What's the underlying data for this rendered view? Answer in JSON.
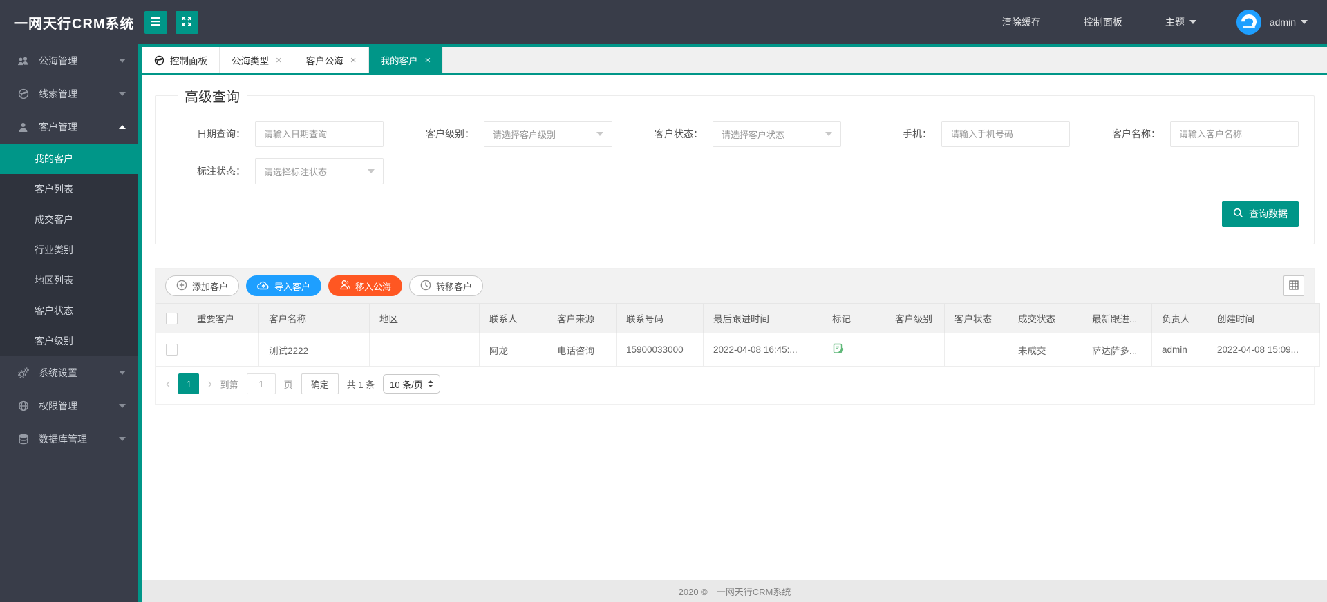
{
  "colors": {
    "accent": "#009688",
    "dark_bg": "#393D49",
    "submenu_bg": "#2F333D",
    "blue": "#1E9FFF",
    "orange": "#FF5722",
    "green_mark": "#5FB878"
  },
  "icons": {
    "hamburger-icon": "menu bars",
    "fullscreen-icon": "expand arrows",
    "chevron-down-icon": "▼",
    "chevron-up-icon": "▲",
    "users-icon": "two persons",
    "globe-icon": "globe",
    "person-icon": "person",
    "gear-icon": "gears",
    "permission-icon": "globe crosshair",
    "database-icon": "cylinder",
    "close-icon": "×",
    "plus-circle-icon": "⊕",
    "cloud-upload-icon": "cloud arrow up",
    "move-users-icon": "person outline",
    "clock-icon": "clock",
    "search-icon": "magnifier",
    "grid-icon": "▦",
    "mark-icon": "green note with pencil",
    "prev-icon": "‹",
    "next-icon": "›",
    "stepper-icon": "⇕"
  },
  "header": {
    "app_title": "一网天行CRM系统",
    "clear_cache": "清除缓存",
    "control_panel": "控制面板",
    "theme": "主题",
    "username": "admin"
  },
  "sidebar": {
    "items": [
      {
        "label": "公海管理"
      },
      {
        "label": "线索管理"
      },
      {
        "label": "客户管理",
        "children": [
          {
            "label": "我的客户"
          },
          {
            "label": "客户列表"
          },
          {
            "label": "成交客户"
          },
          {
            "label": "行业类别"
          },
          {
            "label": "地区列表"
          },
          {
            "label": "客户状态"
          },
          {
            "label": "客户级别"
          }
        ]
      },
      {
        "label": "系统设置"
      },
      {
        "label": "权限管理"
      },
      {
        "label": "数据库管理"
      }
    ]
  },
  "tabs": [
    {
      "label": "控制面板"
    },
    {
      "label": "公海类型"
    },
    {
      "label": "客户公海"
    },
    {
      "label": "我的客户"
    }
  ],
  "query": {
    "legend": "高级查询",
    "date_label": "日期查询：",
    "date_placeholder": "请输入日期查询",
    "level_label": "客户级别：",
    "level_placeholder": "请选择客户级别",
    "status_label": "客户状态：",
    "status_placeholder": "请选择客户状态",
    "phone_label": "手机：",
    "phone_placeholder": "请输入手机号码",
    "name_label": "客户名称：",
    "name_placeholder": "请输入客户名称",
    "mark_label": "标注状态：",
    "mark_placeholder": "请选择标注状态",
    "submit": "查询数据"
  },
  "toolbar": {
    "add": "添加客户",
    "import": "导入客户",
    "move_to_sea": "移入公海",
    "transfer": "转移客户"
  },
  "table": {
    "columns": [
      "重要客户",
      "客户名称",
      "地区",
      "联系人",
      "客户来源",
      "联系号码",
      "最后跟进时间",
      "标记",
      "客户级别",
      "客户状态",
      "成交状态",
      "最新跟进...",
      "负责人",
      "创建时间"
    ],
    "rows": [
      {
        "important": "",
        "name": "测试2222",
        "region": "",
        "contact": "阿龙",
        "source": "电话咨询",
        "phone": "15900033000",
        "last_follow": "2022-04-08 16:45:...",
        "level": "",
        "status": "",
        "deal_status": "未成交",
        "latest_follow": "萨达萨多...",
        "owner": "admin",
        "created": "2022-04-08 15:09..."
      }
    ]
  },
  "pagination": {
    "current_page": "1",
    "goto_prefix": "到第",
    "goto_value": "1",
    "goto_suffix": "页",
    "confirm": "确定",
    "total": "共 1 条",
    "page_size": "10 条/页"
  },
  "footer": {
    "copyright": "2020 ©　一网天行CRM系统"
  }
}
